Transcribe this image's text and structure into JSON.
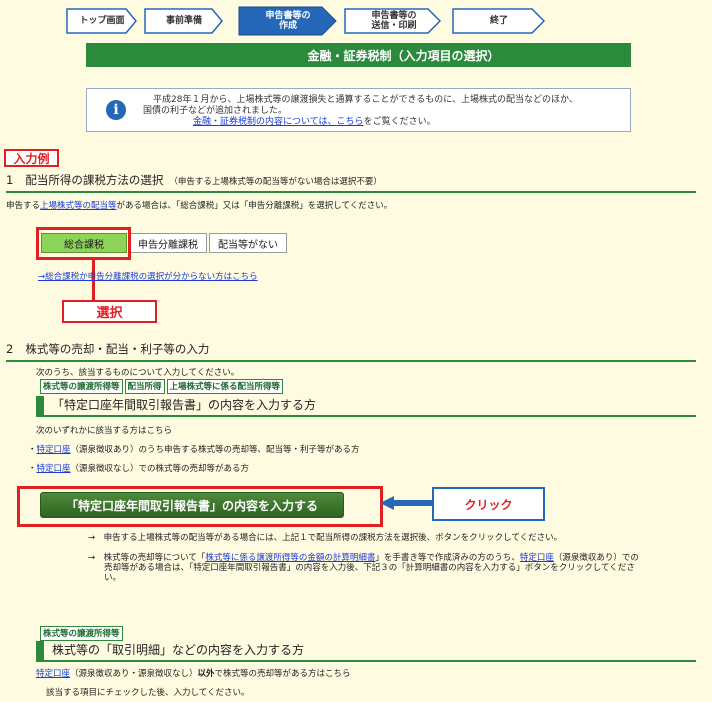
{
  "steps": [
    {
      "label": "トップ画面"
    },
    {
      "label": "事前準備"
    },
    {
      "label": "申告書等の\n作成"
    },
    {
      "label": "申告書等の\n送信・印刷"
    },
    {
      "label": "終了"
    }
  ],
  "title": "金融・証券税制（入力項目の選択）",
  "info": {
    "line1": "平成28年１月から、上場株式等の譲渡損失と通算することができるものに、上場株式の配当などのほか、",
    "line2": "国債の利子などが追加されました。",
    "link": "金融・証券税制の内容については、こちら",
    "link_suffix": "をご覧ください。"
  },
  "example_badge": "入力例",
  "section1": {
    "num": "1",
    "title": "配当所得の課税方法の選択",
    "note": "（申告する上場株式等の配当等がない場合は選択不要）",
    "desc_prefix": "申告する",
    "desc_link": "上場株式等の配当等",
    "desc_suffix": "がある場合は、「総合課税」又は「申告分離課税」を選択してください。",
    "buttons": [
      "総合課税",
      "申告分離課税",
      "配当等がない"
    ],
    "help_link": "→総合課税か申告分離課税の選択が分からない方はこちら",
    "select_label": "選択"
  },
  "section2": {
    "num": "2",
    "title": "株式等の売却・配当・利子等の入力",
    "intro": "次のうち、該当するものについて入力してください。",
    "tags": [
      "株式等の譲渡所得等",
      "配当所得",
      "上場株式等に係る配当所得等"
    ],
    "sub1_title": "「特定口座年間取引報告書」の内容を入力する方",
    "any_applies": "次のいずれかに該当する方はこちら",
    "bullet1_link": "特定口座",
    "bullet1_text": "（源泉徴収あり）のうち申告する株式等の売却等、配当等・利子等がある方",
    "bullet2_link": "特定口座",
    "bullet2_text": "（源泉徴収なし）での株式等の売却等がある方",
    "main_button": "「特定口座年間取引報告書」の内容を入力する",
    "click_label": "クリック",
    "note1": "→　申告する上場株式等の配当等がある場合には、上記１で配当所得の課税方法を選択後、ボタンをクリックしてください。",
    "note2_a": "→　株式等の売却等について「",
    "note2_link": "株式等に係る譲渡所得等の金額の計算明細書",
    "note2_b": "」を手書き等で作成済みの方のうち、",
    "note2_link2": "特定口座",
    "note2_c": "（源泉徴収あり）での",
    "note2_line2": "売却等がある場合は、「特定口座年間取引報告書」の内容を入力後、下記３の「計算明細書の内容を入力する」ボタンをクリックしてくださ",
    "note2_line3": "い。",
    "tag2": "株式等の譲渡所得等",
    "sub2_title": "株式等の「取引明細」などの内容を入力する方",
    "sub2_link": "特定口座",
    "sub2_text_a": "（源泉徴収あり・源泉徴収なし）",
    "sub2_bold": "以外",
    "sub2_text_b": "で株式等の売却等がある方はこちら",
    "sub2_check": "該当する項目にチェックした後、入力してください。"
  },
  "colors": {
    "background": "#fffbe0",
    "green": "#2c8a3c",
    "red": "#e02020",
    "link": "#1a3bd6",
    "selected": "#8ed35a"
  }
}
